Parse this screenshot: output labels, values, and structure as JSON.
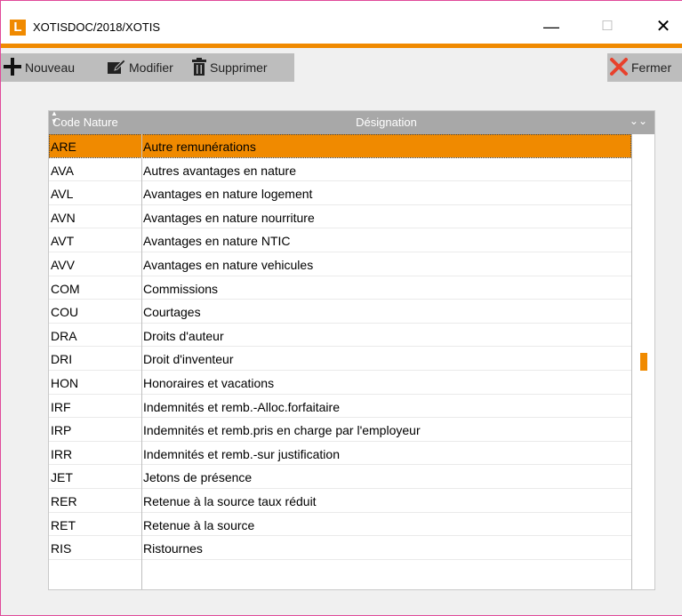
{
  "window": {
    "logo_letter": "L",
    "title": "XOTISDOC/2018/XOTIS",
    "minimize": "—",
    "maximize": "☐",
    "close": "✕"
  },
  "toolbar": {
    "new_label": "Nouveau",
    "modify_label": "Modifier",
    "delete_label": "Supprimer",
    "close_label": "Fermer"
  },
  "grid": {
    "columns": [
      "Code Nature",
      "Désignation"
    ],
    "expand_icon": "⌄⌄",
    "selected_index": 0,
    "scroll_position": 0.5,
    "rows": [
      {
        "code": "ARE",
        "designation": "Autre remunérations"
      },
      {
        "code": "AVA",
        "designation": "Autres avantages en nature"
      },
      {
        "code": "AVL",
        "designation": "Avantages en nature logement"
      },
      {
        "code": "AVN",
        "designation": "Avantages en nature nourriture"
      },
      {
        "code": "AVT",
        "designation": "Avantages en nature NTIC"
      },
      {
        "code": "AVV",
        "designation": "Avantages en nature vehicules"
      },
      {
        "code": "COM",
        "designation": "Commissions"
      },
      {
        "code": "COU",
        "designation": "Courtages"
      },
      {
        "code": "DRA",
        "designation": "Droits d'auteur"
      },
      {
        "code": "DRI",
        "designation": "Droit d'inventeur"
      },
      {
        "code": "HON",
        "designation": "Honoraires et vacations"
      },
      {
        "code": "IRF",
        "designation": "Indemnités et remb.-Alloc.forfaitaire"
      },
      {
        "code": "IRP",
        "designation": "Indemnités et remb.pris en charge par l'employeur"
      },
      {
        "code": "IRR",
        "designation": "Indemnités et remb.-sur justification"
      },
      {
        "code": "JET",
        "designation": "Jetons de présence"
      },
      {
        "code": "RER",
        "designation": "Retenue à la source taux réduit"
      },
      {
        "code": "RET",
        "designation": "Retenue à la source"
      },
      {
        "code": "RIS",
        "designation": "Ristournes"
      }
    ]
  },
  "colors": {
    "accent": "#f08a00",
    "window_border": "#e04a9a",
    "header_bg": "#a8a8a8",
    "button_bg": "#bdbdbd",
    "close_icon": "#e8412c"
  }
}
